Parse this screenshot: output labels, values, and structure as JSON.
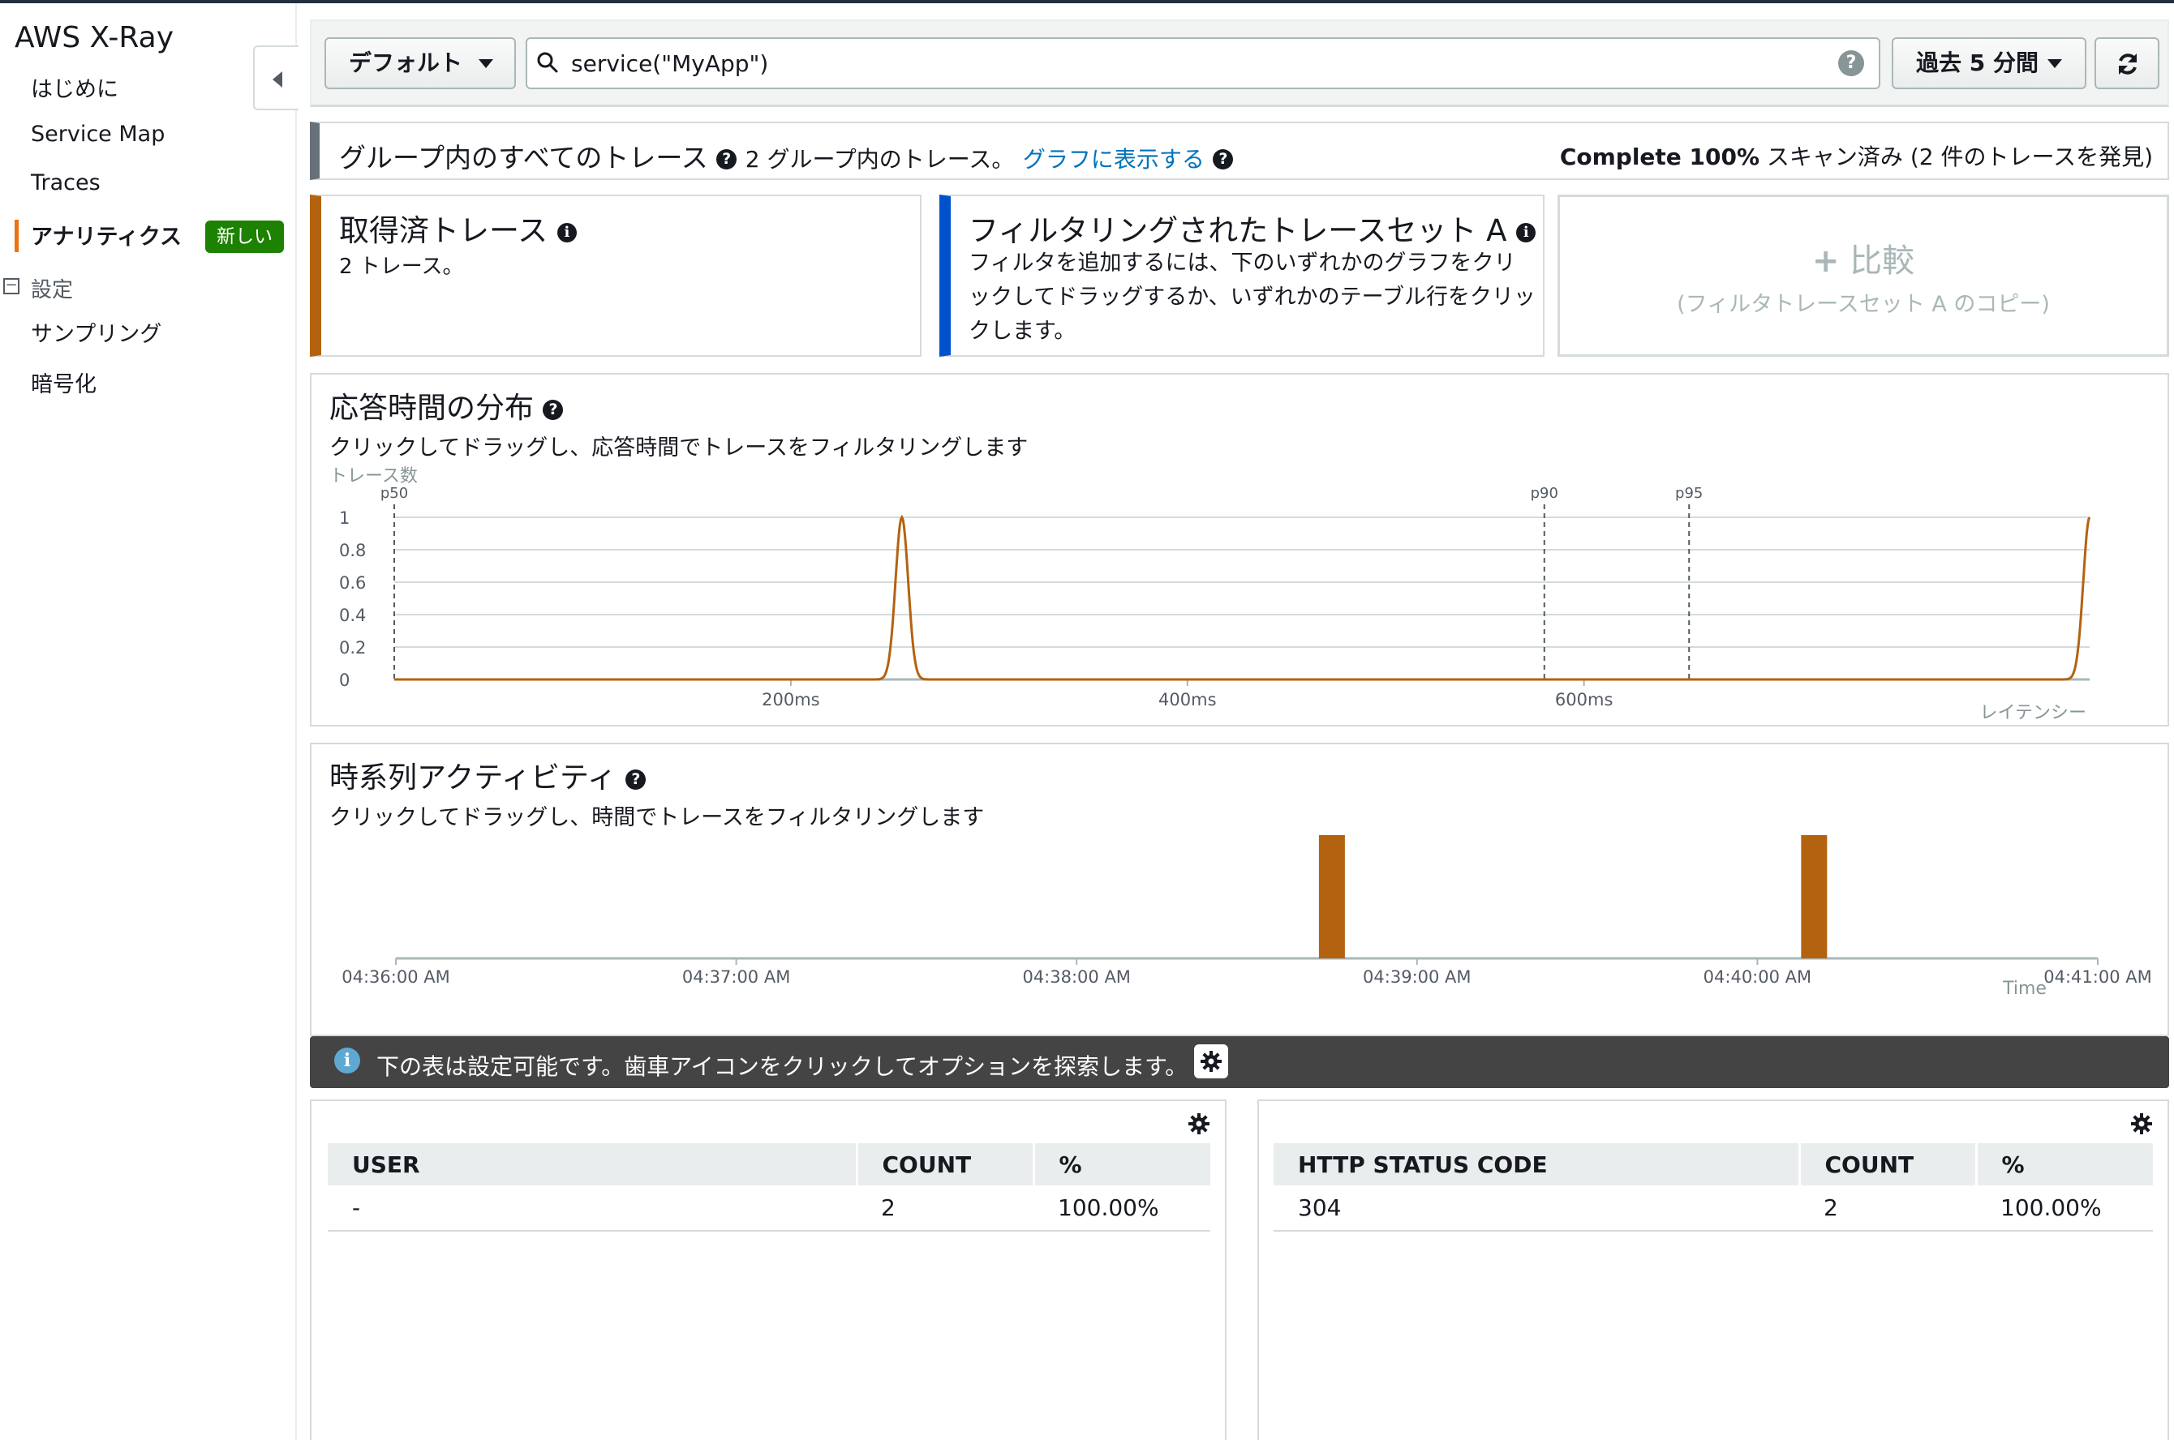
{
  "app": {
    "title": "AWS X-Ray"
  },
  "sidebar": {
    "items": [
      {
        "label": "はじめに"
      },
      {
        "label": "Service Map"
      },
      {
        "label": "Traces"
      },
      {
        "label": "アナリティクス",
        "badge": "新しい",
        "active": true
      }
    ],
    "section": {
      "label": "設定",
      "items": [
        {
          "label": "サンプリング"
        },
        {
          "label": "暗号化"
        }
      ]
    }
  },
  "toolbar": {
    "group_label": "デフォルト",
    "search_value": "service(\"MyApp\")",
    "time_range": "過去 5 分間"
  },
  "groups": {
    "title": "グループ内のすべてのトレース",
    "count_text": "2 グループ内のトレース。",
    "link": "グラフに表示する",
    "scan_complete": "Complete 100%",
    "scan_rest": " スキャン済み (2 件のトレースを発見)"
  },
  "cards": {
    "obtained": {
      "title": "取得済トレース",
      "sub": "2 トレース。"
    },
    "filtered": {
      "title": "フィルタリングされたトレースセット A",
      "body": "フィルタを追加するには、下のいずれかのグラフをクリックしてドラッグするか、いずれかのテーブル行をクリックします。"
    },
    "compare": {
      "title": "比較",
      "sub": "(フィルタトレースセット A のコピー)"
    }
  },
  "latency_panel": {
    "title": "応答時間の分布",
    "sub": "クリックしてドラッグし、応答時間でトレースをフィルタリングします"
  },
  "time_panel": {
    "title": "時系列アクティビティ",
    "sub": "クリックしてドラッグし、時間でトレースをフィルタリングします"
  },
  "info": {
    "text": "下の表は設定可能です。歯車アイコンをクリックしてオプションを探索します。"
  },
  "tables": {
    "user": {
      "headers": [
        "USER",
        "COUNT",
        "%"
      ],
      "rows": [
        [
          "-",
          "2",
          "100.00%"
        ]
      ]
    },
    "http": {
      "headers": [
        "HTTP STATUS CODE",
        "COUNT",
        "%"
      ],
      "rows": [
        [
          "304",
          "2",
          "100.00%"
        ]
      ]
    }
  },
  "colors": {
    "accent": "#ec7211",
    "series": "#b36310",
    "filter": "#0052cc",
    "badge": "#1d8102"
  },
  "chart_data": [
    {
      "type": "line",
      "ylabel": "トレース数",
      "xlabel": "レイテンシー",
      "x_ticks": [
        "200ms",
        "400ms",
        "600ms"
      ],
      "x_tick_values": [
        200,
        400,
        600
      ],
      "y_ticks": [
        "0",
        "0.2",
        "0.4",
        "0.6",
        "0.8",
        "1"
      ],
      "ylim": [
        0,
        1
      ],
      "xlim": [
        0,
        855
      ],
      "percentiles": [
        {
          "label": "p50",
          "x": 0
        },
        {
          "label": "p90",
          "x": 580
        },
        {
          "label": "p95",
          "x": 653
        }
      ],
      "series": [
        {
          "points": [
            [
              0,
              0
            ],
            [
              256,
              1
            ],
            [
              855,
              1
            ]
          ]
        }
      ]
    },
    {
      "type": "bar",
      "xlabel": "Time",
      "x_ticks": [
        "04:36:00 AM",
        "04:37:00 AM",
        "04:38:00 AM",
        "04:39:00 AM",
        "04:40:00 AM",
        "04:41:00 AM"
      ],
      "bars": [
        {
          "time": "04:38:45 AM",
          "value": 1
        },
        {
          "time": "04:40:10 AM",
          "value": 1
        }
      ]
    }
  ]
}
